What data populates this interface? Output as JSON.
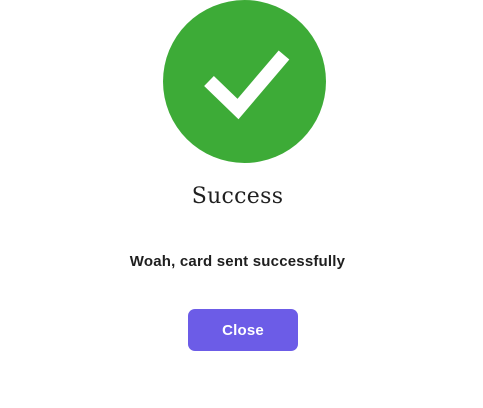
{
  "dialog": {
    "icon": "checkmark-icon",
    "title": "Success",
    "message": "Woah, card sent successfully",
    "close_label": "Close"
  },
  "colors": {
    "success": "#3dab37",
    "button": "#6c5ce7",
    "text": "#1f1f1f"
  }
}
